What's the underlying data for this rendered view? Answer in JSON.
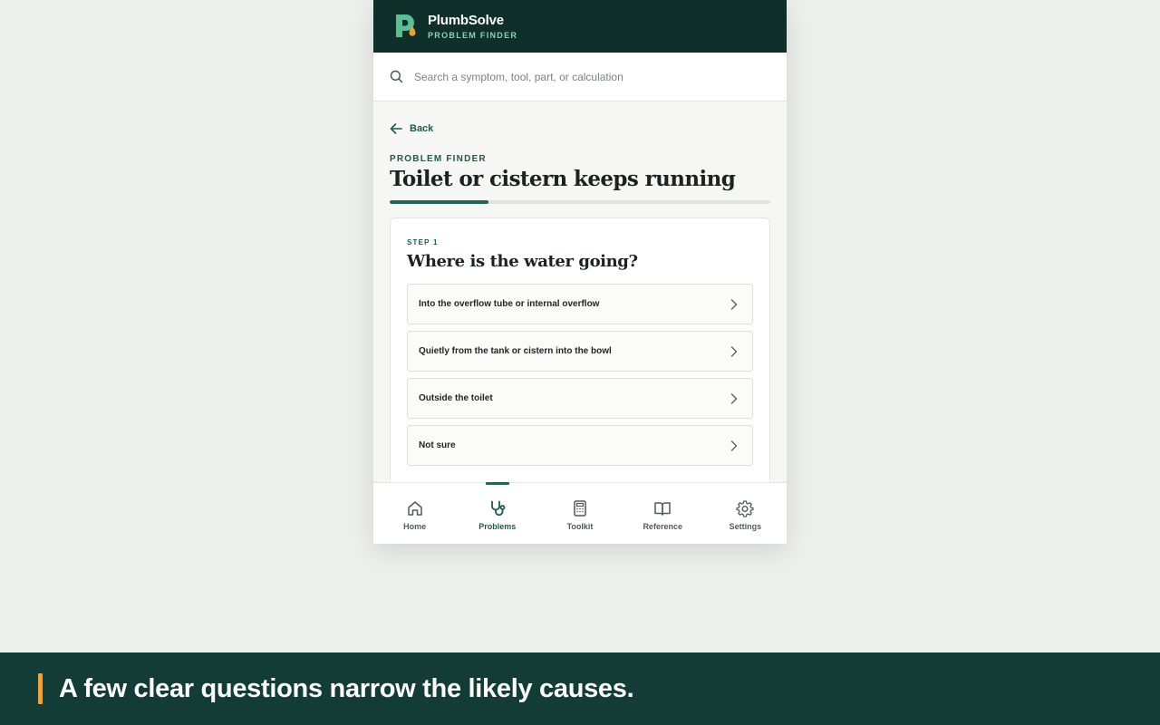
{
  "app": {
    "name": "PlumbSolve",
    "subtitle": "PROBLEM FINDER"
  },
  "search": {
    "placeholder": "Search a symptom, tool, part, or calculation",
    "value": ""
  },
  "nav": {
    "back_label": "Back"
  },
  "page": {
    "kicker": "PROBLEM FINDER",
    "title": "Toilet or cistern keeps running",
    "progress_fraction": 0.26
  },
  "step": {
    "label": "STEP 1",
    "question": "Where is the water going?",
    "options": [
      {
        "label": "Into the overflow tube or internal overflow"
      },
      {
        "label": "Quietly from the tank or cistern into the bowl"
      },
      {
        "label": "Outside the toilet"
      },
      {
        "label": "Not sure"
      }
    ]
  },
  "bottom_nav": {
    "active": "Problems",
    "items": [
      {
        "label": "Home",
        "icon": "home-icon"
      },
      {
        "label": "Problems",
        "icon": "stethoscope-icon"
      },
      {
        "label": "Toolkit",
        "icon": "calculator-icon"
      },
      {
        "label": "Reference",
        "icon": "book-icon"
      },
      {
        "label": "Settings",
        "icon": "gear-icon"
      }
    ]
  },
  "caption": {
    "text": "A few clear questions narrow the likely causes."
  },
  "colors": {
    "header_bg": "#0f302a",
    "accent": "#1f6655",
    "brand_sub": "#8fd0b3",
    "caption_bg": "#133c36",
    "caption_accent": "#e8a33c"
  }
}
